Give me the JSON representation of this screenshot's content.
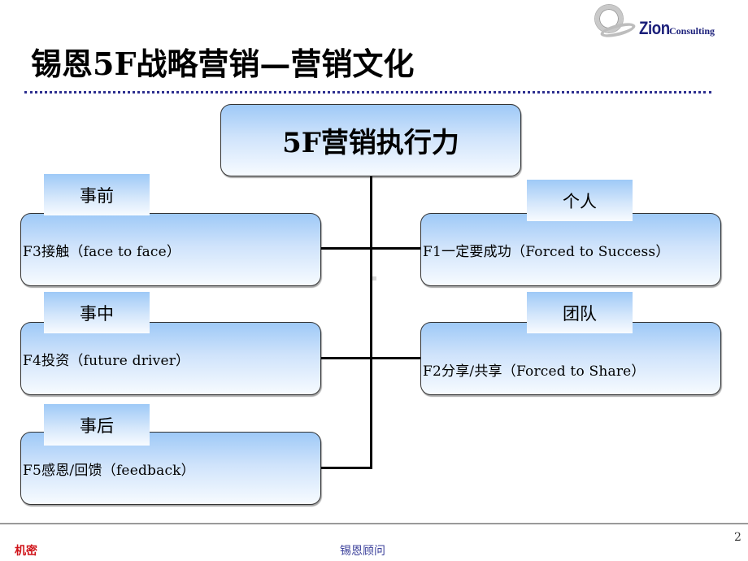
{
  "logo": {
    "icon": "ring-swoosh-icon",
    "brand": "Zion",
    "suffix": "Consulting"
  },
  "title": "锡恩5F战略营销—营销文化",
  "diagram": {
    "root": "5F营销执行力",
    "left": [
      {
        "tag": "事前",
        "text": "F3接触（face to face）"
      },
      {
        "tag": "事中",
        "text": "F4投资（future driver）"
      },
      {
        "tag": "事后",
        "text": "F5感恩/回馈（feedback）"
      }
    ],
    "right": [
      {
        "tag": "个人",
        "text": "F1一定要成功（Forced to Success）"
      },
      {
        "tag": "团队",
        "text": "F2分享/共享（Forced to Share）"
      }
    ]
  },
  "footer": {
    "confidential": "机密",
    "brand": "锡恩顾问",
    "page": "2"
  },
  "colors": {
    "box_gradient_top": "#9ec9f7",
    "box_gradient_bottom": "#f7fbff",
    "title_rule": "#2d2f8f",
    "confidential": "#d0141a",
    "footer_brand": "#3a3f9a",
    "logo_text": "#1b1f7a"
  }
}
